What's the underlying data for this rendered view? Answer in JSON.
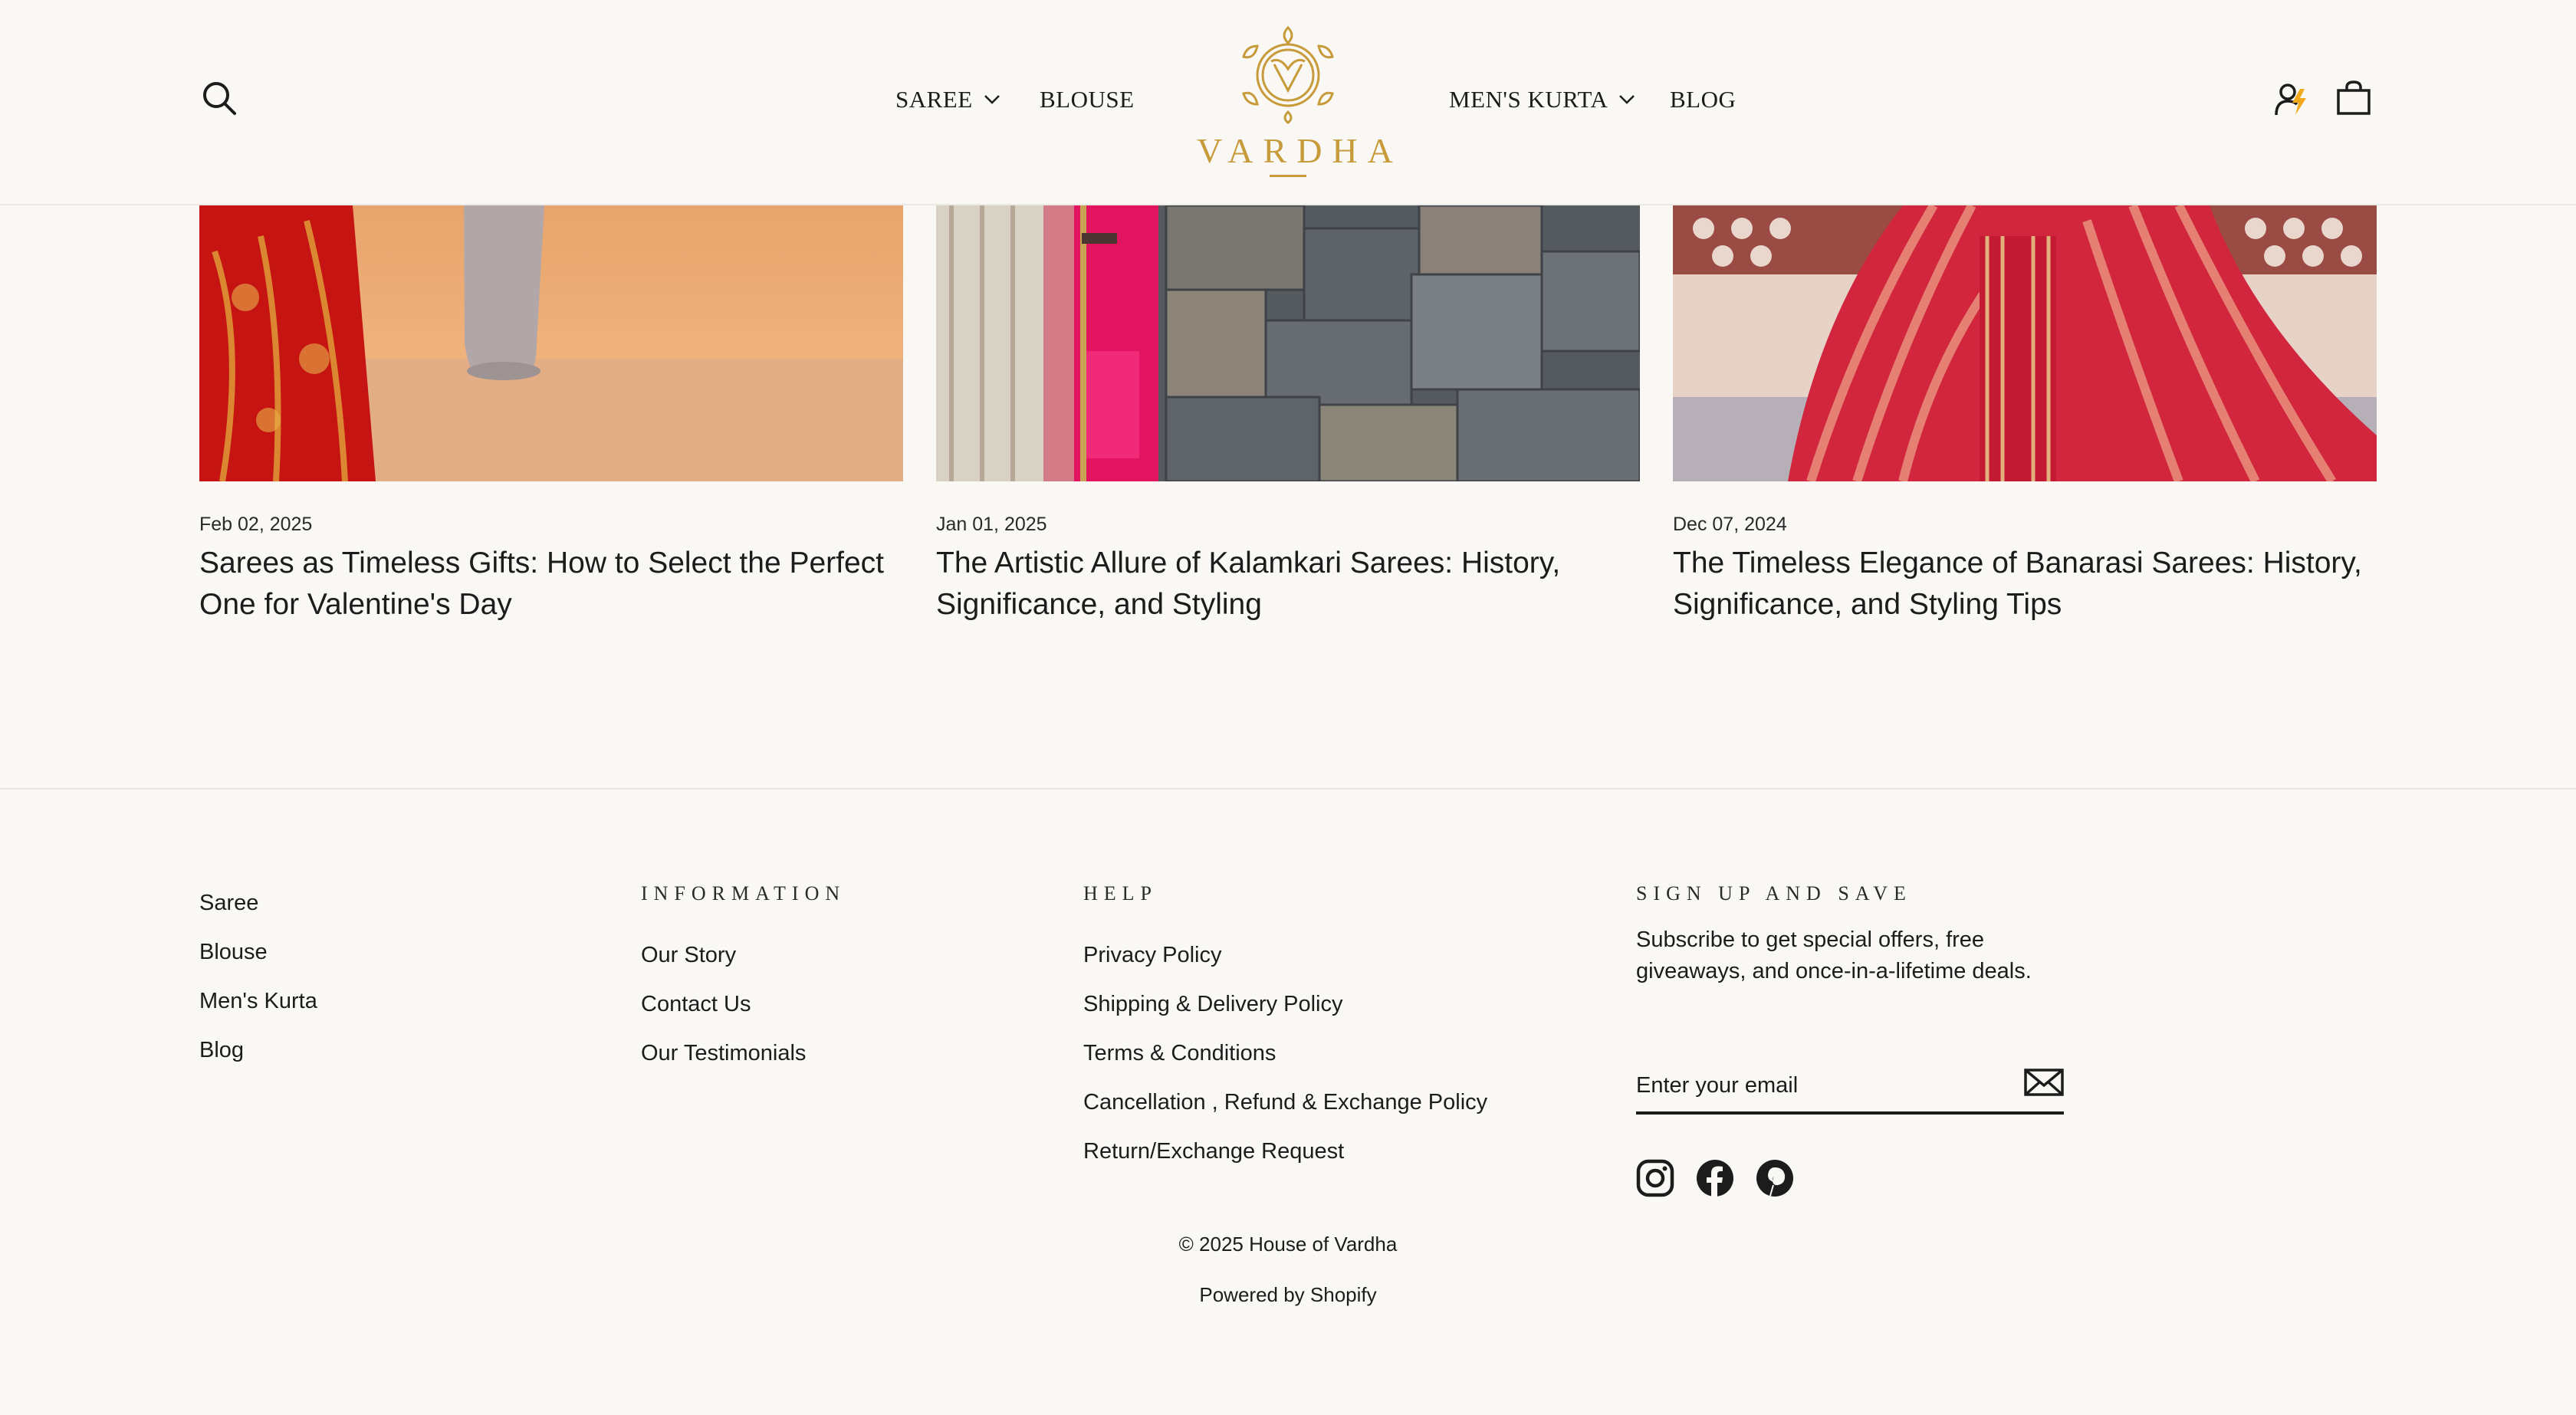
{
  "header": {
    "nav": [
      {
        "label": "SAREE",
        "has_dropdown": true
      },
      {
        "label": "BLOUSE",
        "has_dropdown": false
      },
      {
        "label": "MEN'S KURTA",
        "has_dropdown": true
      },
      {
        "label": "BLOG",
        "has_dropdown": false
      }
    ],
    "logo_text": "VARDHA",
    "icons": [
      "search-icon",
      "account-icon",
      "cart-bag-icon"
    ],
    "brand_color": "#c79a3a"
  },
  "articles": [
    {
      "date": "Feb 02, 2025",
      "title": "Sarees as Timeless Gifts: How to Select the Perfect One for Valentine's Day"
    },
    {
      "date": "Jan 01, 2025",
      "title": "The Artistic Allure of Kalamkari Sarees: History, Significance, and Styling"
    },
    {
      "date": "Dec 07, 2024",
      "title": "The Timeless Elegance of Banarasi Sarees: History, Significance, and Styling Tips"
    }
  ],
  "footer": {
    "shop_links": [
      "Saree",
      "Blouse",
      "Men's Kurta",
      "Blog"
    ],
    "information": {
      "heading": "INFORMATION",
      "links": [
        "Our Story",
        "Contact Us",
        "Our Testimonials"
      ]
    },
    "help": {
      "heading": "HELP",
      "links": [
        "Privacy Policy",
        "Shipping & Delivery Policy",
        "Terms & Conditions",
        "Cancellation , Refund & Exchange Policy",
        "Return/Exchange Request"
      ]
    },
    "signup": {
      "heading": "SIGN UP AND SAVE",
      "text": "Subscribe to get special offers, free giveaways, and once-in-a-lifetime deals.",
      "email_placeholder": "Enter your email",
      "social_icons": [
        "instagram-icon",
        "facebook-icon",
        "pinterest-icon"
      ]
    },
    "copyright": "© 2025 House of Vardha",
    "powered_by": "Powered by Shopify"
  }
}
